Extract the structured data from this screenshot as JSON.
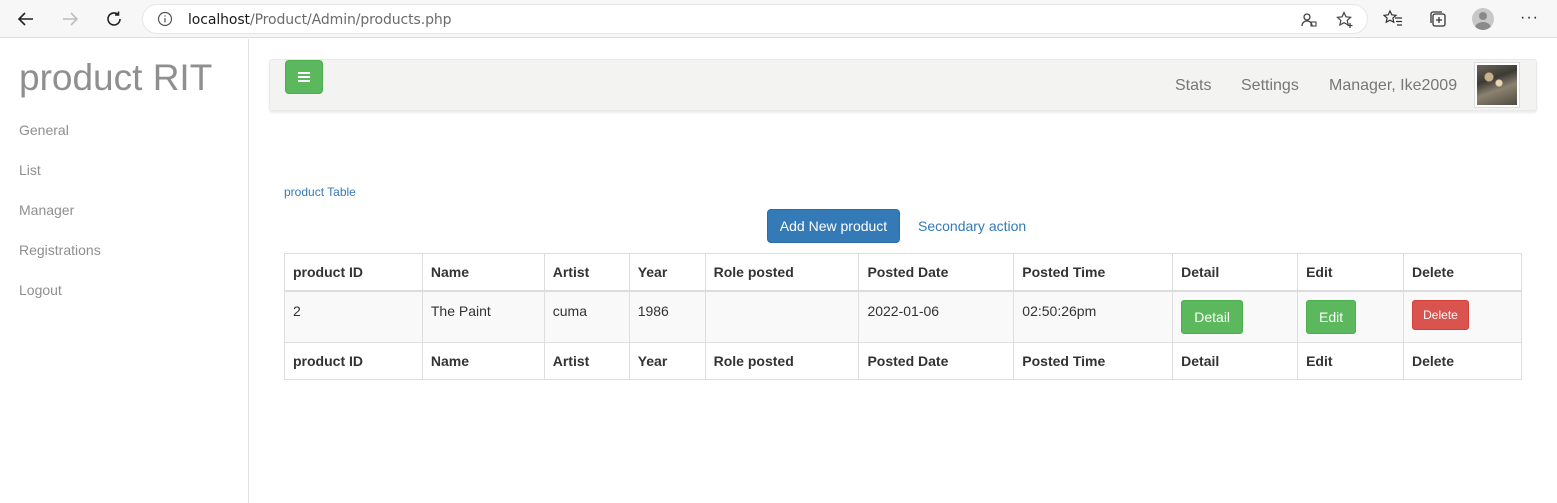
{
  "browser": {
    "url_host": "localhost",
    "url_path": "/Product/Admin/products.php"
  },
  "sidebar": {
    "brand": "product RIT",
    "items": [
      {
        "label": "General"
      },
      {
        "label": "List"
      },
      {
        "label": "Manager"
      },
      {
        "label": "Registrations"
      },
      {
        "label": "Logout"
      }
    ]
  },
  "navbar": {
    "links": [
      {
        "label": "Stats"
      },
      {
        "label": "Settings"
      },
      {
        "label": "Manager, Ike2009"
      }
    ]
  },
  "content": {
    "caption": "product Table",
    "add_button": "Add New product",
    "secondary_action": "Secondary action"
  },
  "table": {
    "headers": [
      "product ID",
      "Name",
      "Artist",
      "Year",
      "Role posted",
      "Posted Date",
      "Posted Time",
      "Detail",
      "Edit",
      "Delete"
    ],
    "rows": [
      {
        "product_id": "2",
        "name": "The Paint",
        "artist": "cuma",
        "year": "1986",
        "role_posted": "",
        "posted_date": "2022-01-06",
        "posted_time": "02:50:26pm",
        "detail_label": "Detail",
        "edit_label": "Edit",
        "delete_label": "Delete"
      }
    ]
  },
  "colors": {
    "primary": "#337ab7",
    "success": "#5cb85c",
    "danger": "#d9534f",
    "navbar_bg": "#f3f3f1"
  },
  "icons": [
    "back-arrow-icon",
    "forward-arrow-icon",
    "refresh-icon",
    "info-icon",
    "tracking-prevention-icon",
    "add-favorite-icon",
    "favorites-icon",
    "collections-icon",
    "profile-icon",
    "more-icon",
    "hamburger-icon"
  ]
}
